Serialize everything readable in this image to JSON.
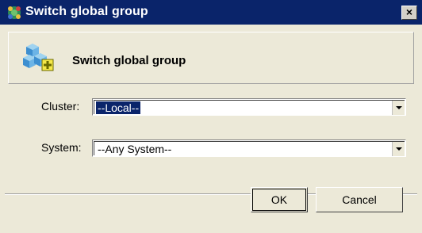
{
  "window": {
    "title": "Switch global group",
    "close_label": "×",
    "title_icon": "globe-group-icon",
    "titlebar_color": "#0a246a"
  },
  "header": {
    "icon": "cubes-add-icon",
    "title": "Switch global group"
  },
  "form": {
    "cluster": {
      "label": "Cluster:",
      "value": "--Local--"
    },
    "system": {
      "label": "System:",
      "value": "--Any System--"
    }
  },
  "buttons": {
    "ok": "OK",
    "cancel": "Cancel"
  },
  "colors": {
    "selection": "#0a246a",
    "dialog_bg": "#ece9d8"
  }
}
